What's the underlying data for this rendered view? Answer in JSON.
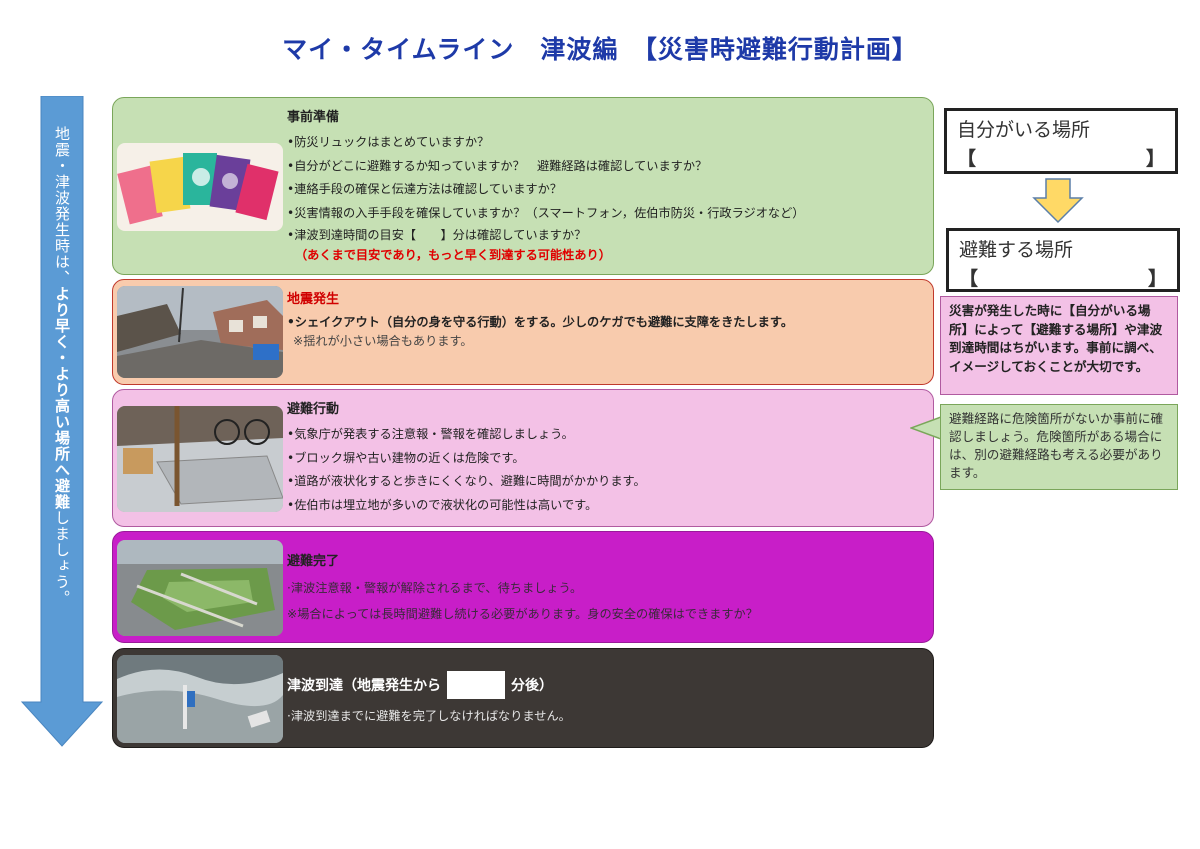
{
  "title": "マイ・タイムライン　津波編　【災害時避難行動計画】",
  "arrow": {
    "part1": "地震・津波発生時は、",
    "part2": "より早く・より高い場所へ避難",
    "part3": "しましょう。"
  },
  "panels": {
    "prep": {
      "title": "事前準備",
      "lines": [
        "•防災リュックはまとめていますか？",
        "•自分がどこに避難するか知っていますか？　避難経路は確認していますか？",
        "•連絡手段の確保と伝達方法は確認していますか？",
        "•災害情報の入手手段を確保していますか？（スマートフォン，佐伯市防災・行政ラジオなど）",
        "•津波到達時間の目安【　　】分は確認していますか？"
      ],
      "note": "（あくまで目安であり，もっと早く到達する可能性あり）"
    },
    "quake": {
      "title": "地震発生",
      "line1": "•シェイクアウト（自分の身を守る行動）をする。少しのケガでも避難に支障をきたします。",
      "line2": "※揺れが小さい場合もあります。"
    },
    "evac": {
      "title": "避難行動",
      "lines": [
        "•気象庁が発表する注意報・警報を確認しましょう。",
        "•ブロック塀や古い建物の近くは危険です。",
        "•道路が液状化すると歩きにくくなり、避難に時間がかかります。",
        "•佐伯市は埋立地が多いので液状化の可能性は高いです。"
      ]
    },
    "done": {
      "title": "避難完了",
      "line1": "·津波注意報・警報が解除されるまで、待ちましょう。",
      "line2": "※場合によっては長時間避難し続ける必要があります。身の安全の確保はできますか？"
    },
    "arrival": {
      "title_a": "津波到達（地震発生から",
      "title_b": "分後）",
      "line1": "·津波到達までに避難を完了しなければなりません。"
    }
  },
  "right": {
    "here_label": "自分がいる場所",
    "here_value": "【　　　　　　　　】",
    "dest_label": "避難する場所",
    "dest_value": "【　　　　　　　　】",
    "pink_note": "災害が発生した時に【自分がいる場所】によって【避難する場所】や津波到達時間はちがいます。事前に調べ、イメージしておくことが大切です。",
    "green_note": "避難経路に危険箇所がないか事前に確認しましょう。危険箇所がある場合には、別の避難経路も考える必要があります。"
  },
  "colors": {
    "title": "#1e3aa8",
    "arrow": "#5b9bd5",
    "prep": "#c6e0b4",
    "quake": "#f8cbad",
    "evac": "#f3c1e6",
    "done": "#c81ec8",
    "arrival": "#3d3835",
    "down_arrow": "#ffd966"
  }
}
